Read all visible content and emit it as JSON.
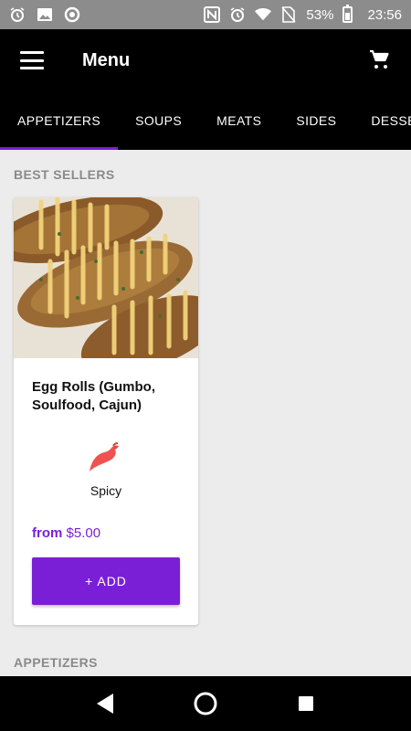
{
  "status_bar": {
    "battery_percent": "53%",
    "time": "23:56",
    "left_icons": [
      "alarm-icon",
      "image-icon",
      "circle-icon"
    ],
    "right_icons": [
      "nfc-icon",
      "alarm-icon",
      "wifi-icon",
      "no-sim-icon",
      "battery-icon"
    ]
  },
  "app_bar": {
    "title": "Menu",
    "menu_icon": "hamburger-menu-icon",
    "cart_icon": "shopping-cart-icon"
  },
  "tabs": [
    {
      "label": "APPETIZERS",
      "active": true
    },
    {
      "label": "SOUPS",
      "active": false
    },
    {
      "label": "MEATS",
      "active": false
    },
    {
      "label": "SIDES",
      "active": false
    },
    {
      "label": "DESSERTS",
      "active": false
    }
  ],
  "sections": {
    "best_sellers": "BEST SELLERS",
    "appetizers": "APPETIZERS"
  },
  "product": {
    "name": "Egg Rolls (Gumbo, Soulfood, Cajun)",
    "tag": "Spicy",
    "price_prefix": "from",
    "price": "$5.00",
    "add_label": "+ ADD"
  },
  "colors": {
    "accent": "#7a1fd6",
    "app_bar": "#000000",
    "background": "#ececec"
  }
}
